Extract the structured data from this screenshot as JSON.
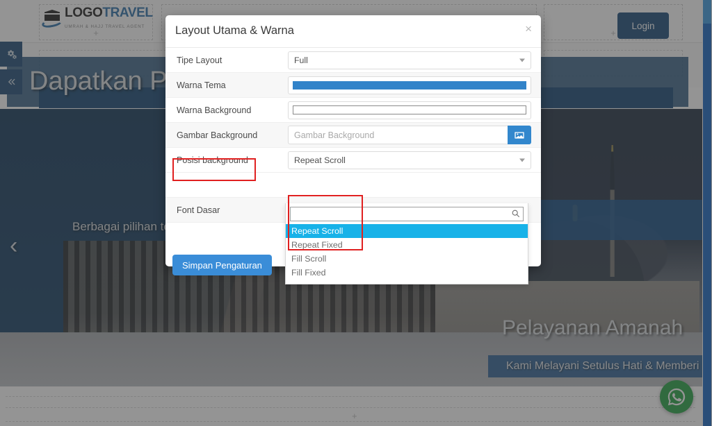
{
  "page": {
    "logo": {
      "main_dark_1": "L",
      "main_rest_1": "OGO",
      "main_dark_2": "T",
      "main_rest_2": "RAVEL",
      "tagline": "UMRAH & HAJJ TRAVEL AGENT"
    },
    "login_label": "Login",
    "plus_marks": [
      "+",
      "+",
      "+"
    ],
    "hero": {
      "slide1_title": "Dapatkan Paket Menarik",
      "slide1_subtitle": "Berbagai pilihan terbaik dari kami untuk Anda",
      "slide2_title": "Pelayanan Amanah",
      "slide2_subtitle": "Kami Melayani Setulus Hati & Memberi",
      "prev_arrow": "‹"
    },
    "rail": {
      "settings_icon": "gears-icon",
      "collapse_icon": "double-chevron-left-icon"
    },
    "whatsapp_icon": "whatsapp-icon"
  },
  "modal": {
    "title": "Layout Utama & Warna",
    "close_label": "×",
    "save_label": "Simpan Pengaturan",
    "fields": [
      {
        "label": "Tipe Layout",
        "type": "select",
        "value": "Full"
      },
      {
        "label": "Warna Tema",
        "type": "color",
        "value": "#3283c9"
      },
      {
        "label": "Warna Background",
        "type": "color",
        "value": ""
      },
      {
        "label": "Gambar Background",
        "type": "image",
        "value": "",
        "placeholder": "Gambar Background",
        "button_icon": "image-icon"
      },
      {
        "label": "Posisi background",
        "type": "select",
        "value": "Repeat Scroll"
      },
      {
        "label": "Font Dasar",
        "type": "select",
        "value": ""
      }
    ],
    "dropdown": {
      "search_value": "",
      "search_icon": "search-icon",
      "options": [
        "Repeat Scroll",
        "Repeat Fixed",
        "Fill Scroll",
        "Fill Fixed"
      ],
      "selected": "Repeat Scroll"
    },
    "annotations": {
      "highlight_color": "#e02020",
      "boxes": [
        "posisi-background-label",
        "dropdown-options-list"
      ]
    }
  }
}
